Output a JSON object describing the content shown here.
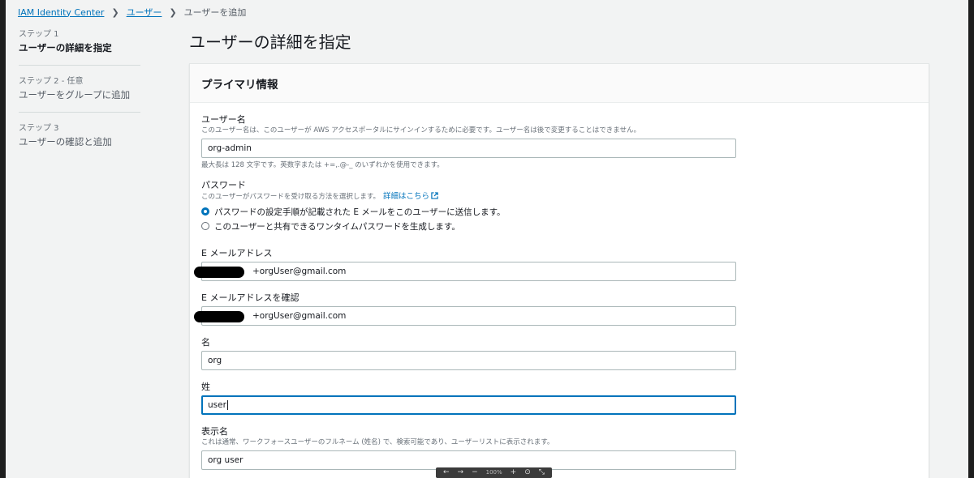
{
  "breadcrumb": {
    "root": "IAM Identity Center",
    "users": "ユーザー",
    "current": "ユーザーを追加"
  },
  "steps": [
    {
      "num": "ステップ 1",
      "title": "ユーザーの詳細を指定"
    },
    {
      "num": "ステップ 2 - 任意",
      "title": "ユーザーをグループに追加"
    },
    {
      "num": "ステップ 3",
      "title": "ユーザーの確認と追加"
    }
  ],
  "page_title": "ユーザーの詳細を指定",
  "section_title": "プライマリ情報",
  "username": {
    "label": "ユーザー名",
    "desc": "このユーザー名は、このユーザーが AWS アクセスポータルにサインインするために必要です。ユーザー名は後で変更することはできません。",
    "value": "org-admin",
    "hint": "最大長は 128 文字です。英数字または +=,.@-_ のいずれかを使用できます。"
  },
  "password": {
    "label": "パスワード",
    "desc": "このユーザーがパスワードを受け取る方法を選択します。",
    "link": "詳細はこちら",
    "option1": "パスワードの設定手順が記載された E メールをこのユーザーに送信します。",
    "option2": "このユーザーと共有できるワンタイムパスワードを生成します。"
  },
  "email": {
    "label": "E メールアドレス",
    "value": "+orgUser@gmail.com"
  },
  "email_confirm": {
    "label": "E メールアドレスを確認",
    "value": "+orgUser@gmail.com"
  },
  "first_name": {
    "label": "名",
    "value": "org"
  },
  "last_name": {
    "label": "姓",
    "value": "user"
  },
  "display_name": {
    "label": "表示名",
    "desc": "これは通常、ワークフォースユーザーのフルネーム (姓名) で、検索可能であり、ユーザーリストに表示されます。",
    "value": "org user"
  },
  "zoom": {
    "back": "←",
    "forward": "→",
    "minus": "−",
    "level": "100%",
    "plus": "+",
    "reset": "⊙",
    "fit": "⤡"
  },
  "colors": {
    "accent": "#0073bb",
    "background": "#f2f3f3"
  }
}
